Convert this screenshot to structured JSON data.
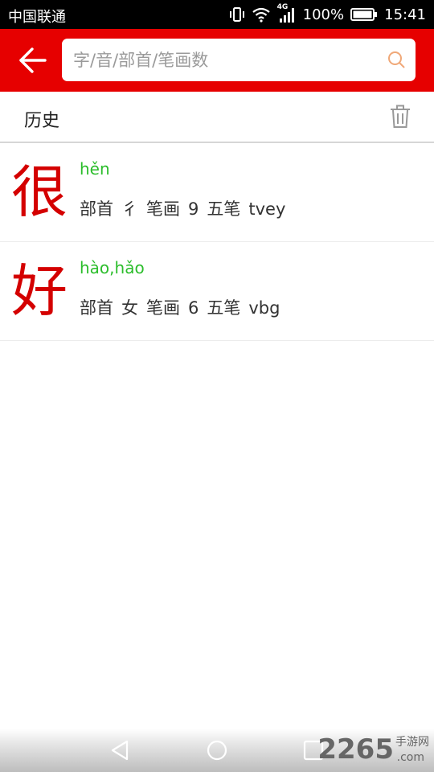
{
  "status_bar": {
    "carrier": "中国联通",
    "network": "4G",
    "battery": "100%",
    "time": "15:41"
  },
  "search": {
    "placeholder": "字/音/部首/笔画数"
  },
  "history": {
    "title": "历史"
  },
  "labels": {
    "radical": "部首",
    "strokes": "笔画",
    "wubi": "五笔"
  },
  "entries": [
    {
      "char": "很",
      "pinyin": "hěn",
      "radical": "彳",
      "strokes": "9",
      "wubi": "tvey"
    },
    {
      "char": "好",
      "pinyin": "hào,hǎo",
      "radical": "女",
      "strokes": "6",
      "wubi": "vbg"
    }
  ],
  "watermark": {
    "number": "2265",
    "text": "手游网",
    "suffix": ".com"
  },
  "colors": {
    "accent": "#e60000",
    "char_red": "#d40000",
    "pinyin_green": "#2bbd2b"
  }
}
